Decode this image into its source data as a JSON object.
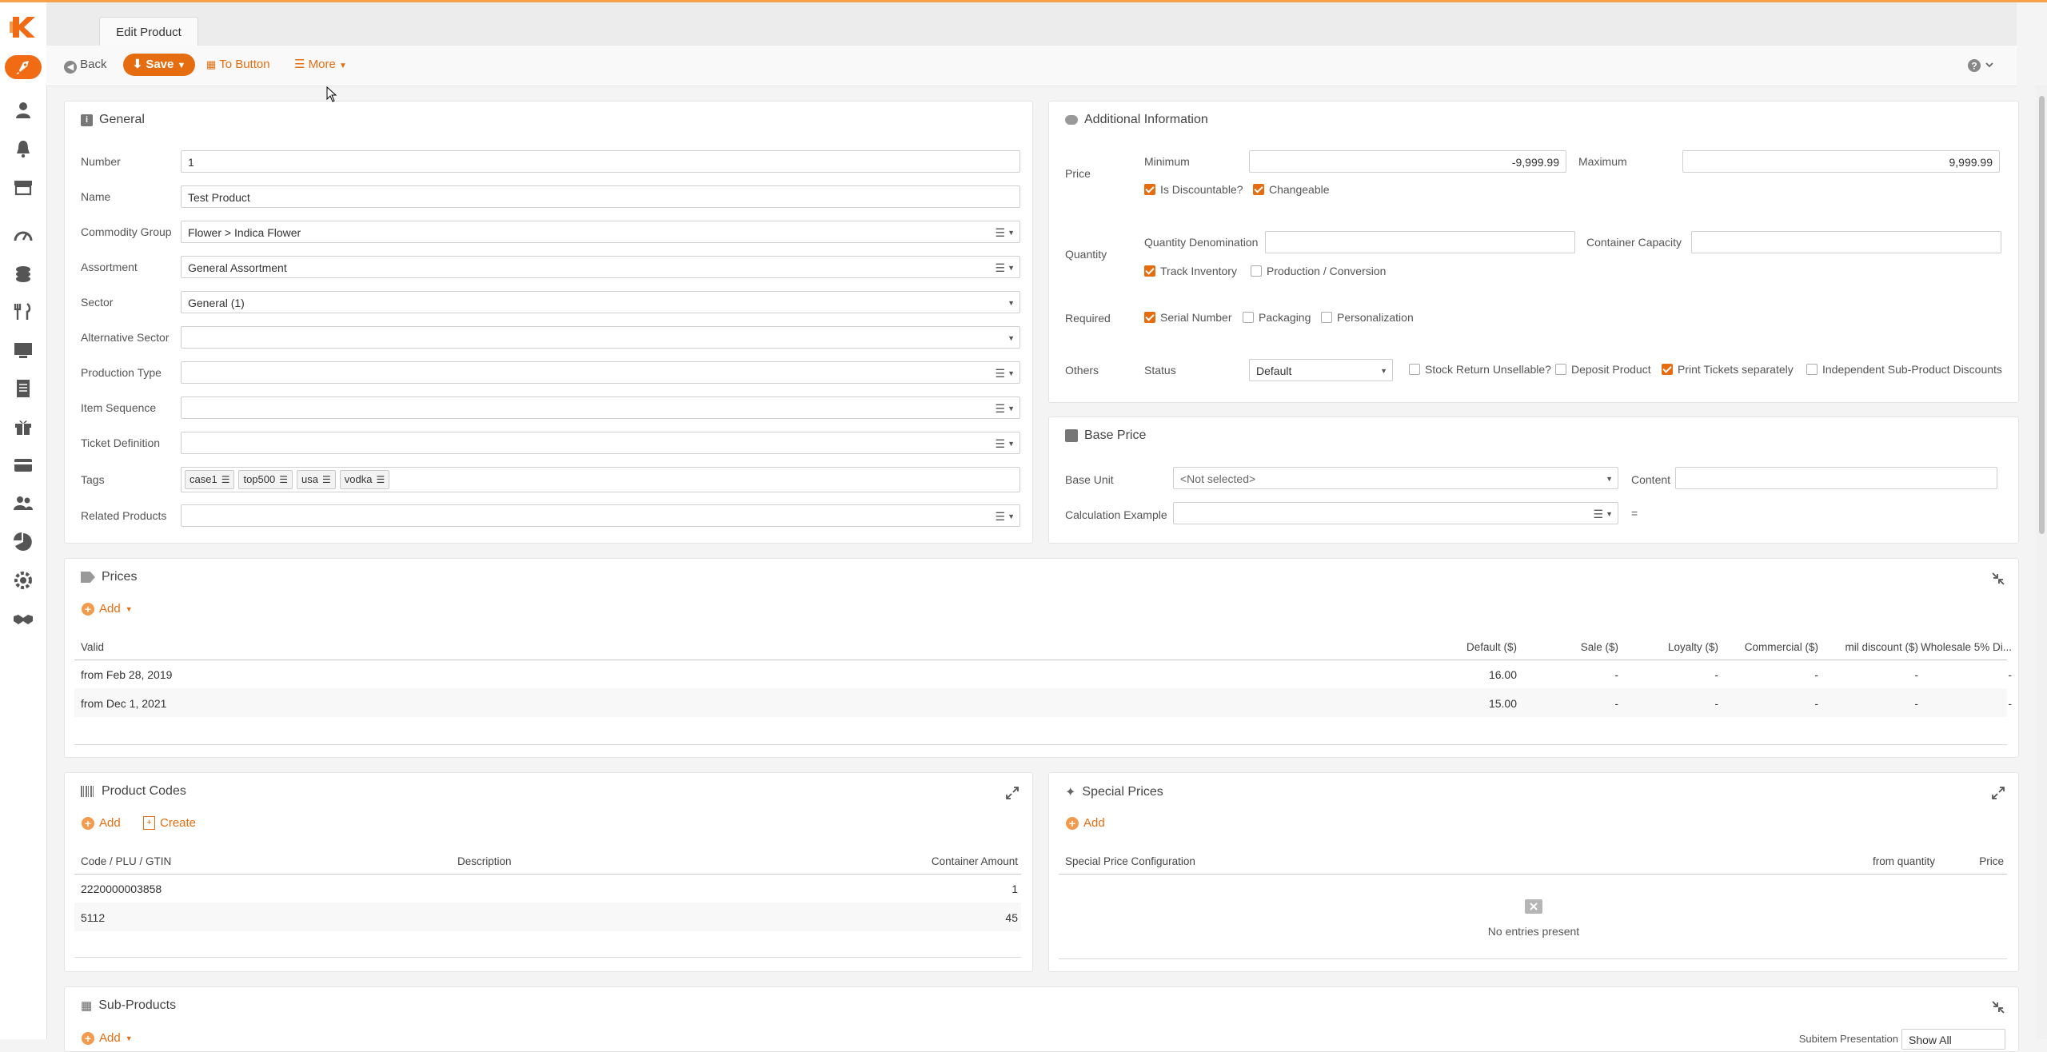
{
  "tab": {
    "title": "Edit Product"
  },
  "toolbar": {
    "back": "Back",
    "save": "Save",
    "to_button": "To Button",
    "more": "More"
  },
  "general": {
    "title": "General",
    "number_label": "Number",
    "number_value": "1",
    "name_label": "Name",
    "name_value": "Test Product",
    "commodity_label": "Commodity Group",
    "commodity_value": "Flower > Indica Flower",
    "assortment_label": "Assortment",
    "assortment_value": "General Assortment",
    "sector_label": "Sector",
    "sector_value": "General (1)",
    "alt_sector_label": "Alternative Sector",
    "alt_sector_value": "",
    "production_type_label": "Production Type",
    "production_type_value": "",
    "item_sequence_label": "Item Sequence",
    "item_sequence_value": "",
    "ticket_def_label": "Ticket Definition",
    "ticket_def_value": "",
    "tags_label": "Tags",
    "tags": [
      "case1",
      "top500",
      "usa",
      "vodka"
    ],
    "related_label": "Related Products",
    "related_value": ""
  },
  "additional": {
    "title": "Additional Information",
    "price_label": "Price",
    "minimum_label": "Minimum",
    "minimum_value": "-9,999.99",
    "maximum_label": "Maximum",
    "maximum_value": "9,999.99",
    "is_discountable": "Is Discountable?",
    "is_discountable_checked": true,
    "changeable": "Changeable",
    "changeable_checked": true,
    "quantity_label": "Quantity",
    "qty_denom_label": "Quantity Denomination",
    "qty_denom_value": "",
    "container_cap_label": "Container Capacity",
    "container_cap_value": "",
    "track_inventory": "Track Inventory",
    "track_inventory_checked": true,
    "production_conversion": "Production / Conversion",
    "production_conversion_checked": false,
    "required_label": "Required",
    "serial_number": "Serial Number",
    "serial_number_checked": true,
    "packaging": "Packaging",
    "packaging_checked": false,
    "personalization": "Personalization",
    "personalization_checked": false,
    "others_label": "Others",
    "status_label": "Status",
    "status_value": "Default",
    "stock_return": "Stock Return Unsellable?",
    "stock_return_checked": false,
    "deposit_product": "Deposit Product",
    "deposit_product_checked": false,
    "print_tickets": "Print Tickets separately",
    "print_tickets_checked": true,
    "independent_sub": "Independent Sub-Product Discounts",
    "independent_sub_checked": false
  },
  "base_price": {
    "title": "Base Price",
    "base_unit_label": "Base Unit",
    "base_unit_value": "<Not selected>",
    "content_label": "Content",
    "content_value": "",
    "calc_label": "Calculation Example",
    "calc_value": "",
    "equals": "="
  },
  "prices": {
    "title": "Prices",
    "add": "Add",
    "columns": [
      "Valid",
      "Default ($)",
      "Sale ($)",
      "Loyalty ($)",
      "Commercial ($)",
      "mil discount ($)",
      "Wholesale 5% Di..."
    ],
    "rows": [
      [
        "from Feb 28, 2019",
        "16.00",
        "-",
        "-",
        "-",
        "-",
        "-"
      ],
      [
        "from Dec 1, 2021",
        "15.00",
        "-",
        "-",
        "-",
        "-",
        "-"
      ]
    ]
  },
  "product_codes": {
    "title": "Product Codes",
    "add": "Add",
    "create": "Create",
    "columns": [
      "Code / PLU / GTIN",
      "Description",
      "Container Amount"
    ],
    "rows": [
      [
        "2220000003858",
        "",
        "1"
      ],
      [
        "5112",
        "",
        "45"
      ]
    ]
  },
  "special_prices": {
    "title": "Special Prices",
    "add": "Add",
    "columns": [
      "Special Price Configuration",
      "from quantity",
      "Price"
    ],
    "empty": "No entries present"
  },
  "sub_products": {
    "title": "Sub-Products",
    "add": "Add",
    "subitem_label": "Subitem Presentation",
    "subitem_value": "Show All"
  },
  "colors": {
    "accent": "#e56d10",
    "panel_border": "#e4e4e4"
  }
}
